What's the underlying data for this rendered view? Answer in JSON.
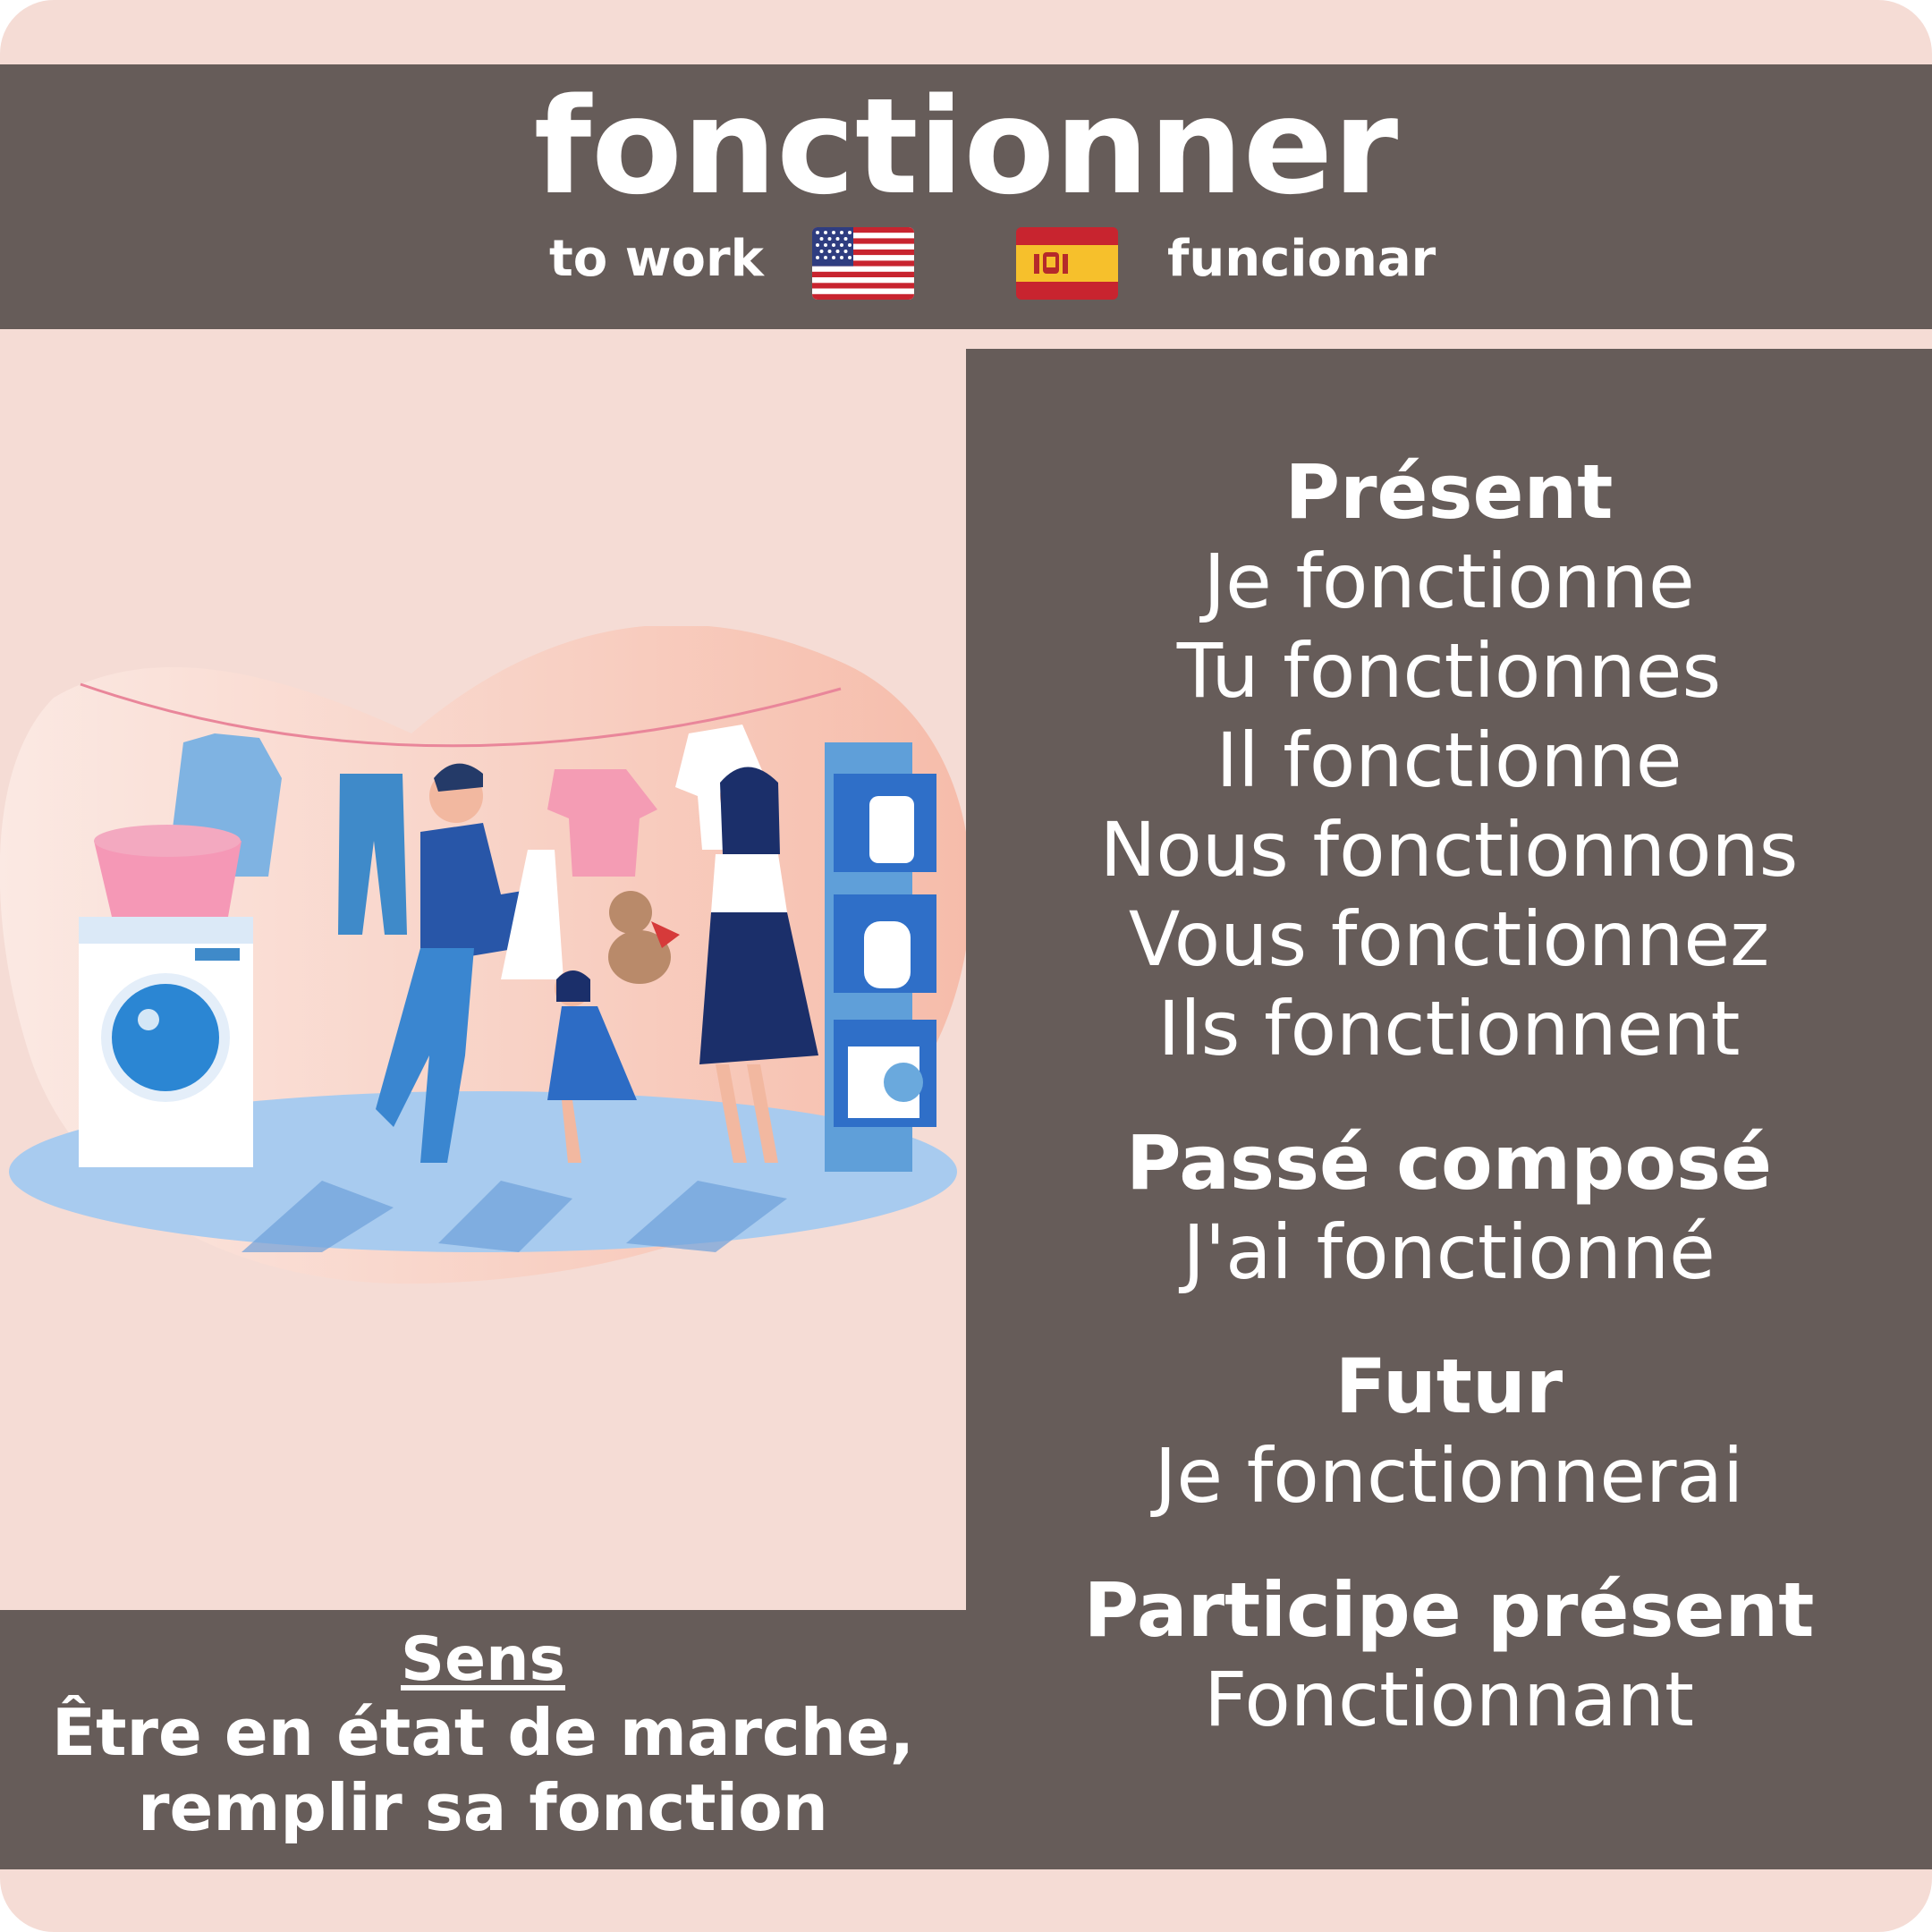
{
  "verb": "fonctionner",
  "translations": {
    "english": "to work",
    "spanish": "funcionar",
    "english_flag_icon": "us-flag-icon",
    "spanish_flag_icon": "spain-flag-icon"
  },
  "conjugations": {
    "present": {
      "label": "Présent",
      "forms": [
        "Je fonctionne",
        "Tu fonctionnes",
        "Il fonctionne",
        "Nous fonctionnons",
        "Vous fonctionnez",
        "Ils fonctionnent"
      ]
    },
    "passe_compose": {
      "label": "Passé composé",
      "form": "J'ai fonctionné"
    },
    "futur": {
      "label": "Futur",
      "form": "Je fonctionnerai"
    },
    "participe_present": {
      "label": "Participe présent",
      "form": "Fonctionnant"
    }
  },
  "meaning": {
    "label": "Sens",
    "line1": "Être en état de marche,",
    "line2": "remplir sa fonction"
  },
  "colors": {
    "background": "#f5dcd5",
    "panel": "#665c59",
    "text": "#ffffff"
  }
}
